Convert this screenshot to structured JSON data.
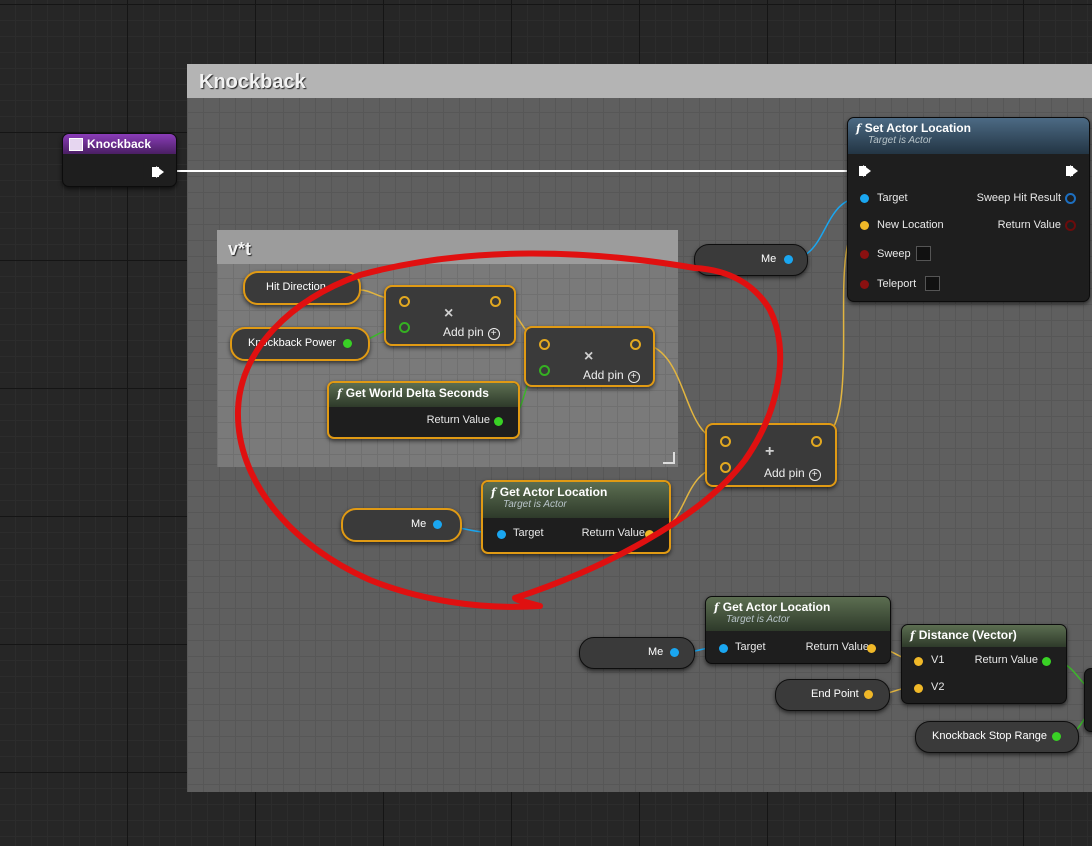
{
  "comments": {
    "main": {
      "title": "Knockback"
    },
    "vt": {
      "title": "v*t"
    }
  },
  "event": {
    "title": "Knockback"
  },
  "set_actor_location": {
    "title": "Set Actor Location",
    "subtitle": "Target is Actor",
    "pins": {
      "target": "Target",
      "new_location": "New Location",
      "sweep": "Sweep",
      "teleport": "Teleport",
      "sweep_hit_result": "Sweep Hit Result",
      "return_value": "Return Value"
    }
  },
  "self_refs": {
    "label": "Me"
  },
  "variables": {
    "hit_direction": "Hit Direction",
    "knockback_power": "Knockback Power",
    "end_point": "End Point",
    "knockback_stop_range": "Knockback Stop Range"
  },
  "math": {
    "add_pin": "Add pin",
    "multiply_symbol": "×",
    "add_symbol": "+"
  },
  "get_world_delta_seconds": {
    "title": "Get World Delta Seconds",
    "return_value": "Return Value"
  },
  "get_actor_location": {
    "title": "Get Actor Location",
    "subtitle": "Target is Actor",
    "target": "Target",
    "return_value": "Return Value"
  },
  "distance_vector": {
    "title": "Distance (Vector)",
    "v1": "V1",
    "v2": "V2",
    "return_value": "Return Value"
  },
  "icons": {
    "function": "f",
    "event": "event-icon"
  },
  "colors": {
    "selection": "#e09a14",
    "vector_pin": "#f0b828",
    "float_pin": "#39d125",
    "object_pin": "#1aa6f0",
    "annotation": "#e01010"
  }
}
